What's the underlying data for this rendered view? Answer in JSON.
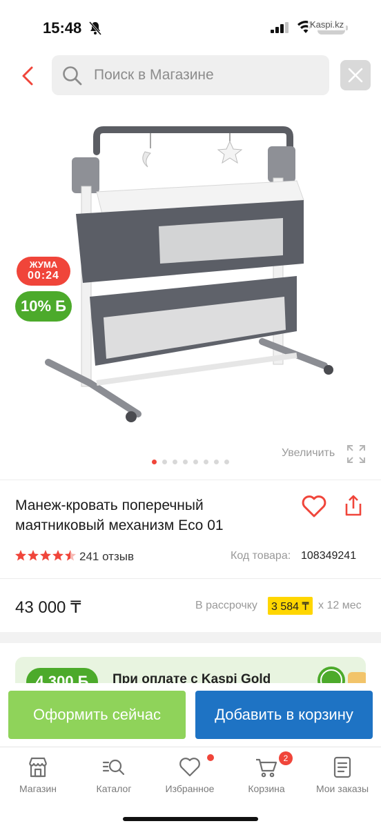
{
  "status_bar": {
    "time": "15:48",
    "battery": "16",
    "source_label": "Kaspi.kz"
  },
  "header": {
    "search_placeholder": "Поиск в Магазине"
  },
  "gallery": {
    "badge_day_label": "ЖУМА",
    "badge_day_time": "00:24",
    "badge_bonus": "10% Б",
    "zoom_label": "Увеличить",
    "dots_total": 8,
    "dots_active_index": 0
  },
  "product": {
    "title": "Манеж-кровать поперечный маятниковый механизм Eco 01",
    "rating": 4.5,
    "reviews": "241 отзыв",
    "code_label": "Код товара:",
    "code_value": "108349241",
    "price": "43 000 ₸",
    "installment_prefix": "В рассрочку",
    "installment_amount": "3 584 ₸",
    "installment_suffix": "x 12 мес"
  },
  "promo": {
    "badge": "4 300 Б",
    "text": "При оплате с Kaspi Gold"
  },
  "actions": {
    "buy_now": "Оформить сейчас",
    "add_to_cart": "Добавить в корзину"
  },
  "tabbar": {
    "items": [
      {
        "label": "Магазин",
        "icon": "store-icon"
      },
      {
        "label": "Каталог",
        "icon": "catalog-search-icon"
      },
      {
        "label": "Избранное",
        "icon": "heart-icon"
      },
      {
        "label": "Корзина",
        "icon": "cart-icon"
      },
      {
        "label": "Мои заказы",
        "icon": "orders-icon"
      }
    ],
    "cart_count": "2"
  },
  "colors": {
    "accent_red": "#f0453a",
    "kaspi_green": "#4caa2b",
    "buy_now_green": "#8fd35a",
    "cart_blue": "#1e73c4",
    "installment_yellow": "#ffd600"
  }
}
